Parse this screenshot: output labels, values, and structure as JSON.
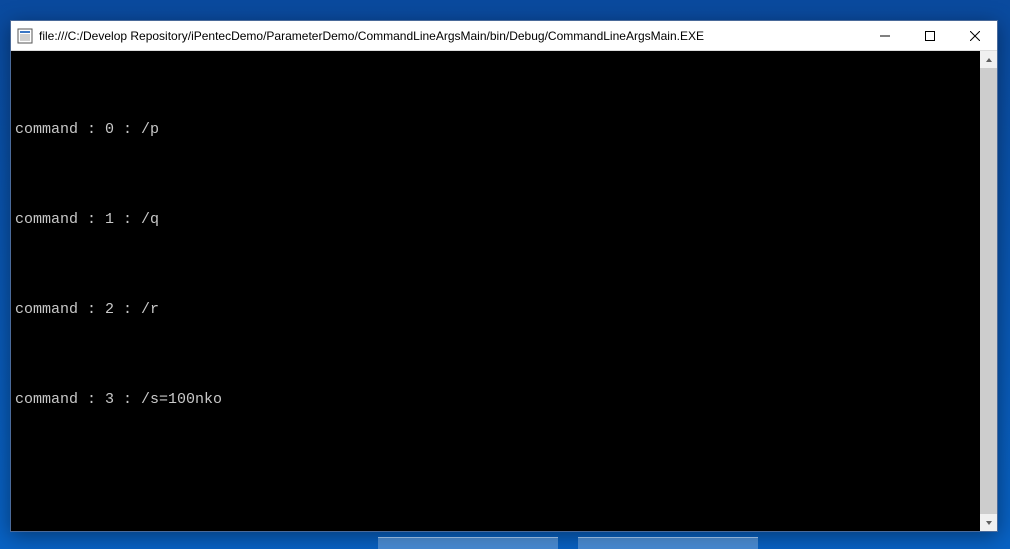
{
  "window": {
    "title": "file:///C:/Develop Repository/iPentecDemo/ParameterDemo/CommandLineArgsMain/bin/Debug/CommandLineArgsMain.EXE"
  },
  "console": {
    "lines": [
      "command : 0 : /p",
      "command : 1 : /q",
      "command : 2 : /r",
      "command : 3 : /s=100nko"
    ]
  }
}
